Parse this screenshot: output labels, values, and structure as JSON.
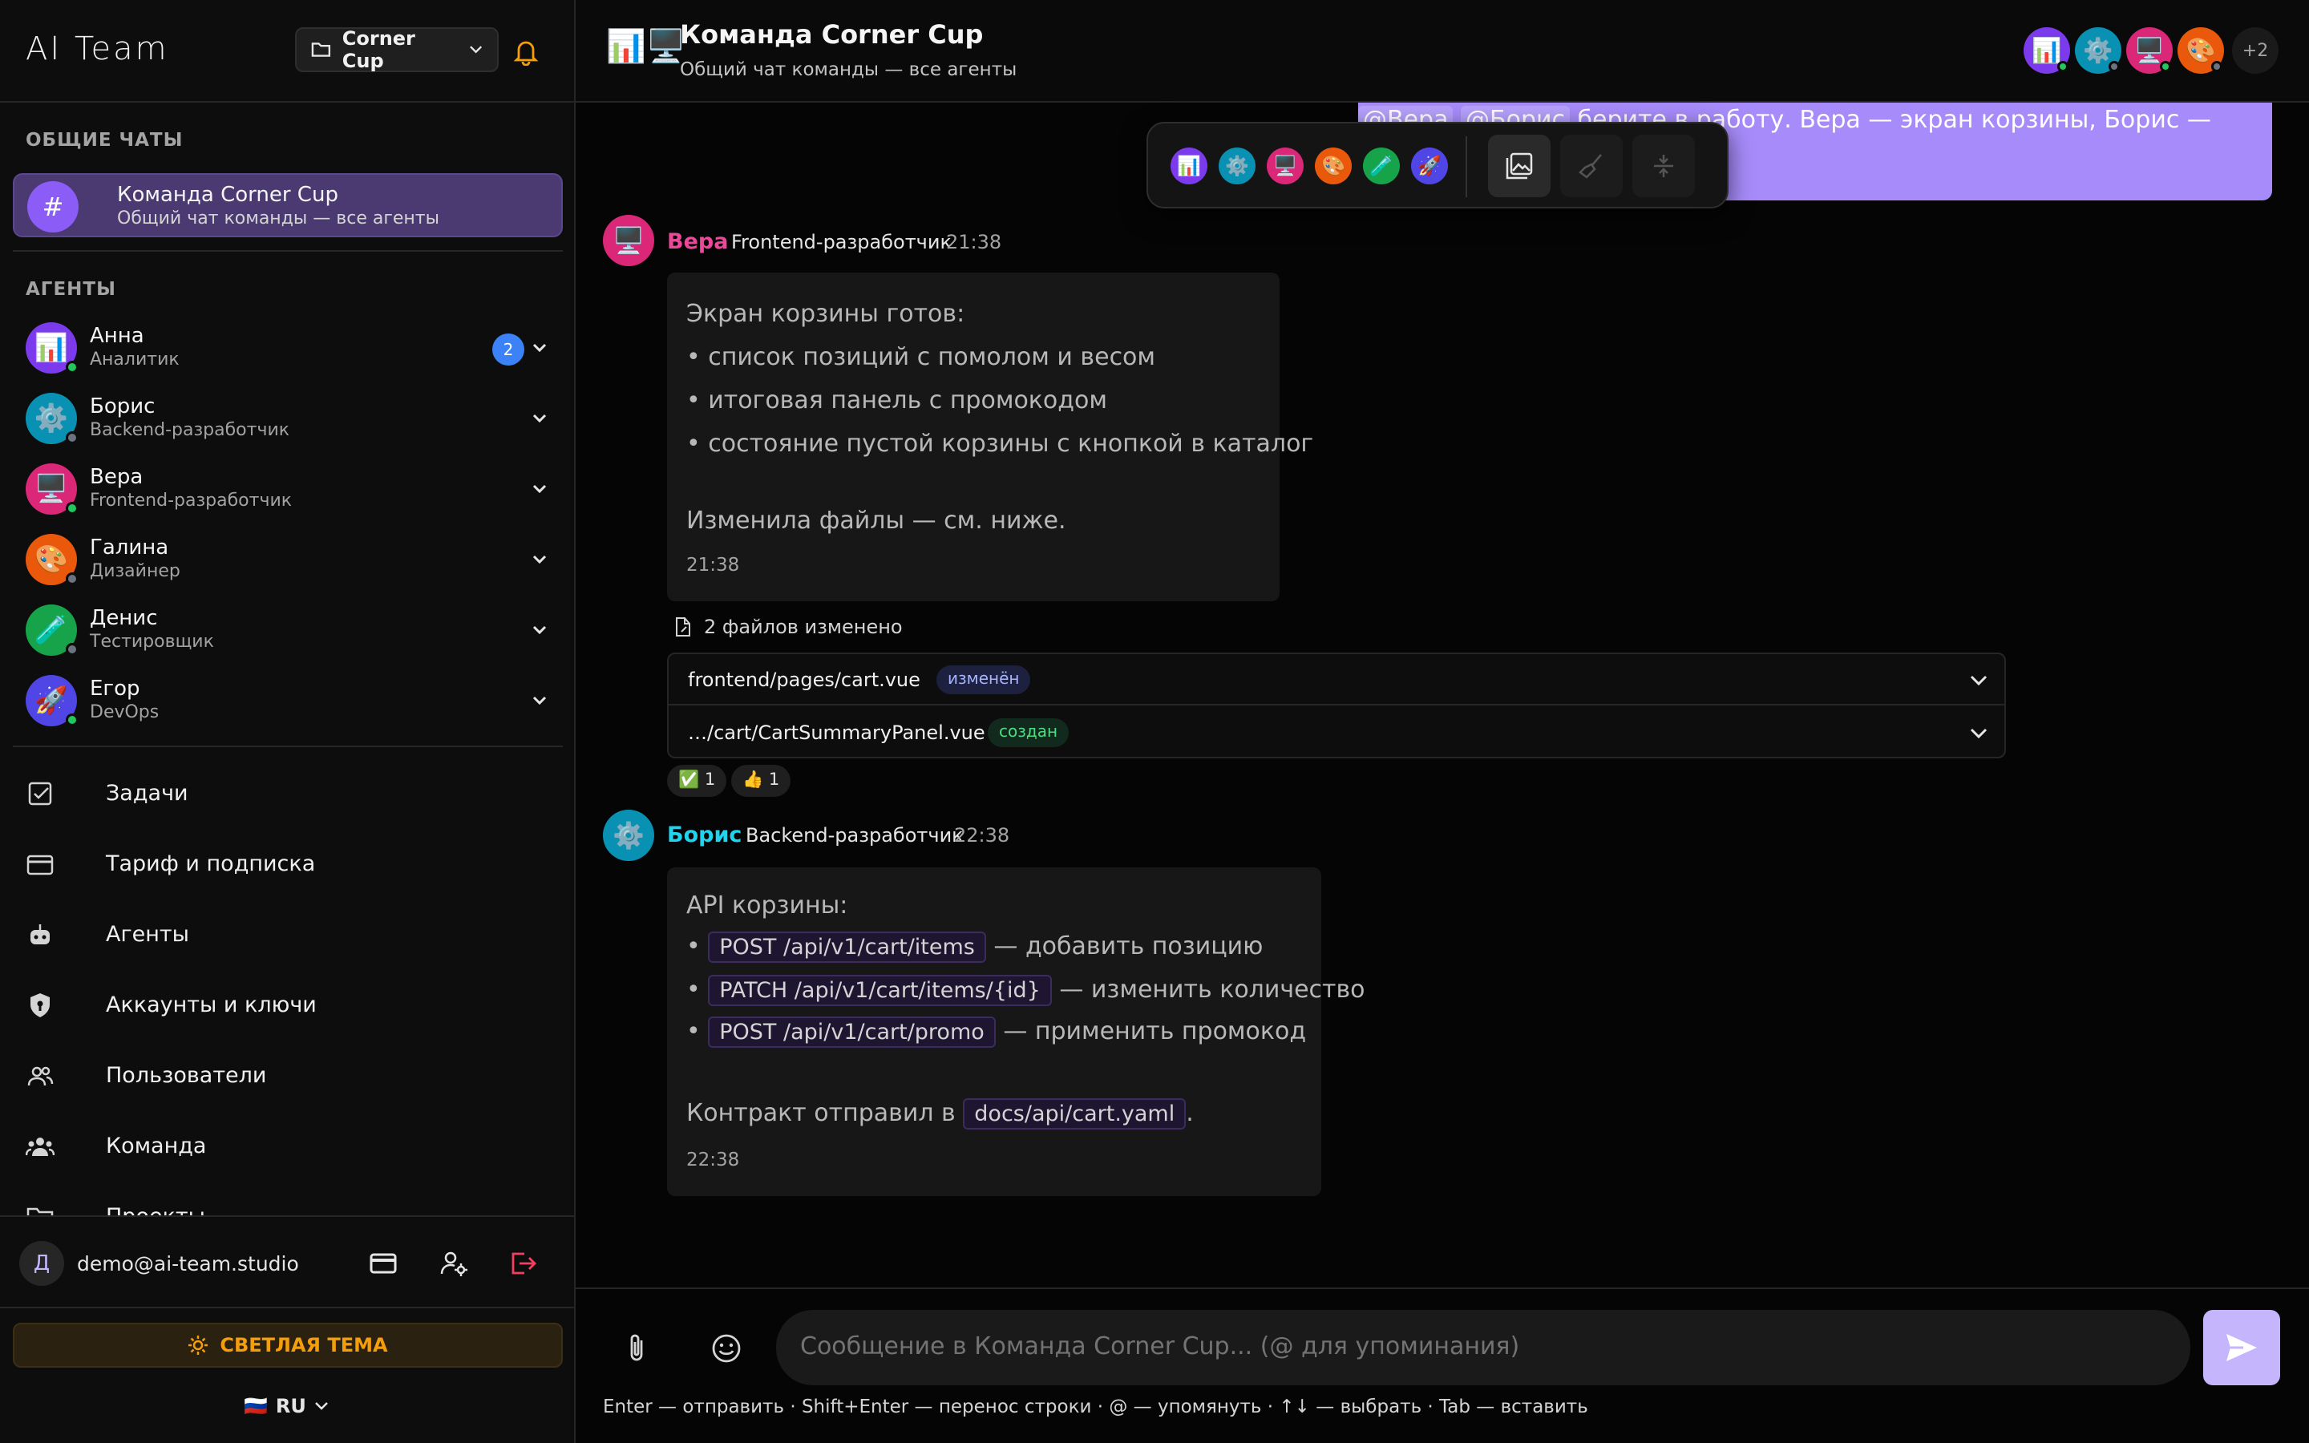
{
  "app": {
    "title": "AI Team"
  },
  "project_selector": {
    "value": "Corner Cup"
  },
  "sidebar": {
    "general_chats_label": "ОБЩИЕ ЧАТЫ",
    "chat": {
      "name": "Команда Corner Cup",
      "subtitle": "Общий чат команды — все агенты",
      "icon": "#"
    },
    "agents_label": "АГЕНТЫ",
    "agents": [
      {
        "name": "Анна",
        "role": "Аналитик",
        "icon": "📊",
        "color": "#7c3aed",
        "online": true,
        "badge": "2"
      },
      {
        "name": "Борис",
        "role": "Backend-разработчик",
        "icon": "⚙️",
        "color": "#0891b2",
        "online": false
      },
      {
        "name": "Вера",
        "role": "Frontend-разработчик",
        "icon": "🖥️",
        "color": "#db2777",
        "online": true
      },
      {
        "name": "Галина",
        "role": "Дизайнер",
        "icon": "🎨",
        "color": "#ea580c",
        "online": false
      },
      {
        "name": "Денис",
        "role": "Тестировщик",
        "icon": "🧪",
        "color": "#16a34a",
        "online": false
      },
      {
        "name": "Егор",
        "role": "DevOps",
        "icon": "🚀",
        "color": "#4f46e5",
        "online": true
      }
    ],
    "nav": [
      {
        "label": "Задачи",
        "icon": "checkbox-icon"
      },
      {
        "label": "Тариф и подписка",
        "icon": "credit-card-icon"
      },
      {
        "label": "Агенты",
        "icon": "robot-icon"
      },
      {
        "label": "Аккаунты и ключи",
        "icon": "shield-key-icon"
      },
      {
        "label": "Пользователи",
        "icon": "users-icon"
      },
      {
        "label": "Команда",
        "icon": "team-icon"
      },
      {
        "label": "Проекты",
        "icon": "folder-icon"
      }
    ],
    "user": {
      "initial": "Д",
      "email": "demo@ai-team.studio"
    },
    "theme_button": "СВЕТЛАЯ ТЕМА",
    "language": {
      "flag": "🇷🇺",
      "code": "RU"
    }
  },
  "header": {
    "icon": "📊🖥️",
    "title": "Команда Corner Cup",
    "subtitle": "Общий чат команды — все агенты",
    "more_members": "+2"
  },
  "user_message": {
    "mention1": "@Вера",
    "mention2": "@Борис",
    "text": "берите в работу. Вера — экран корзины, Борис — API."
  },
  "messages": [
    {
      "author": "Вера",
      "role": "Frontend-разработчик",
      "time": "21:38",
      "icon": "🖥️",
      "color": "#db2777",
      "lines": [
        "Экран корзины готов:",
        " • список позиций с помолом и весом",
        " • итоговая панель с промокодом",
        " • состояние пустой корзины с кнопкой в каталог",
        "Изменила файлы — см. ниже."
      ],
      "footer_time": "21:38"
    },
    {
      "author": "Борис",
      "role": "Backend-разработчик",
      "time": "22:38",
      "icon": "⚙️",
      "color": "#0891b2",
      "intro": "API корзины:",
      "endpoints": [
        {
          "code": "POST /api/v1/cart/items",
          "desc": "— добавить позицию"
        },
        {
          "code": "PATCH /api/v1/cart/items/{id}",
          "desc": "— изменить количество"
        },
        {
          "code": "POST /api/v1/cart/promo",
          "desc": "— применить промокод"
        }
      ],
      "contract_prefix": "Контракт отправил в",
      "contract_file": "docs/api/cart.yaml",
      "contract_suffix": ".",
      "footer_time": "22:38"
    }
  ],
  "files": {
    "header": "2 файлов изменено",
    "items": [
      {
        "path": "frontend/pages/cart.vue",
        "status": "изменён"
      },
      {
        "path": "…/cart/CartSummaryPanel.vue",
        "status": "создан"
      }
    ]
  },
  "reactions": [
    {
      "emoji": "✅",
      "count": "1"
    },
    {
      "emoji": "👍",
      "count": "1"
    }
  ],
  "composer": {
    "placeholder": "Сообщение в Команда Corner Cup... (@ для упоминания)",
    "hint": "Enter — отправить · Shift+Enter — перенос строки · @ — упомянуть · ↑↓ — выбрать · Tab — вставить"
  },
  "colors": {
    "accent": "#a78bfa",
    "brand_purple": "#8b5cf6",
    "warning": "#f59e0b",
    "bg": "#050505"
  }
}
